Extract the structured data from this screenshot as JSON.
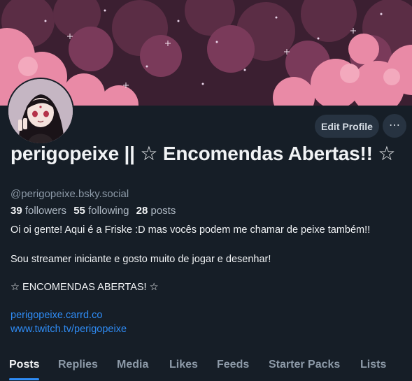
{
  "profile": {
    "display_name": "perigopeixe || ☆ Encomendas Abertas!! ☆",
    "handle": "@perigopeixe.bsky.social"
  },
  "actions": {
    "edit_label": "Edit Profile",
    "more_label": "⋯"
  },
  "stats": {
    "followers_count": "39",
    "followers_label": "followers",
    "following_count": "55",
    "following_label": "following",
    "posts_count": "28",
    "posts_label": "posts"
  },
  "bio": {
    "line1": "Oi oi gente! Aqui é a Friske :D mas vocês podem me chamar de peixe também!!",
    "line2": "Sou streamer iniciante e gosto muito de jogar e desenhar!",
    "line3": "☆ ENCOMENDAS ABERTAS! ☆",
    "link1": "perigopeixe.carrd.co",
    "link2": "www.twitch.tv/perigopeixe"
  },
  "tabs": [
    {
      "label": "Posts",
      "active": true
    },
    {
      "label": "Replies"
    },
    {
      "label": "Media"
    },
    {
      "label": "Likes"
    },
    {
      "label": "Feeds"
    },
    {
      "label": "Starter Packs"
    },
    {
      "label": "Lists"
    }
  ],
  "colors": {
    "background": "#161e27",
    "accent": "#2f8cf5",
    "banner_pink": "#e98aa6",
    "banner_dark": "#3a1e30"
  }
}
